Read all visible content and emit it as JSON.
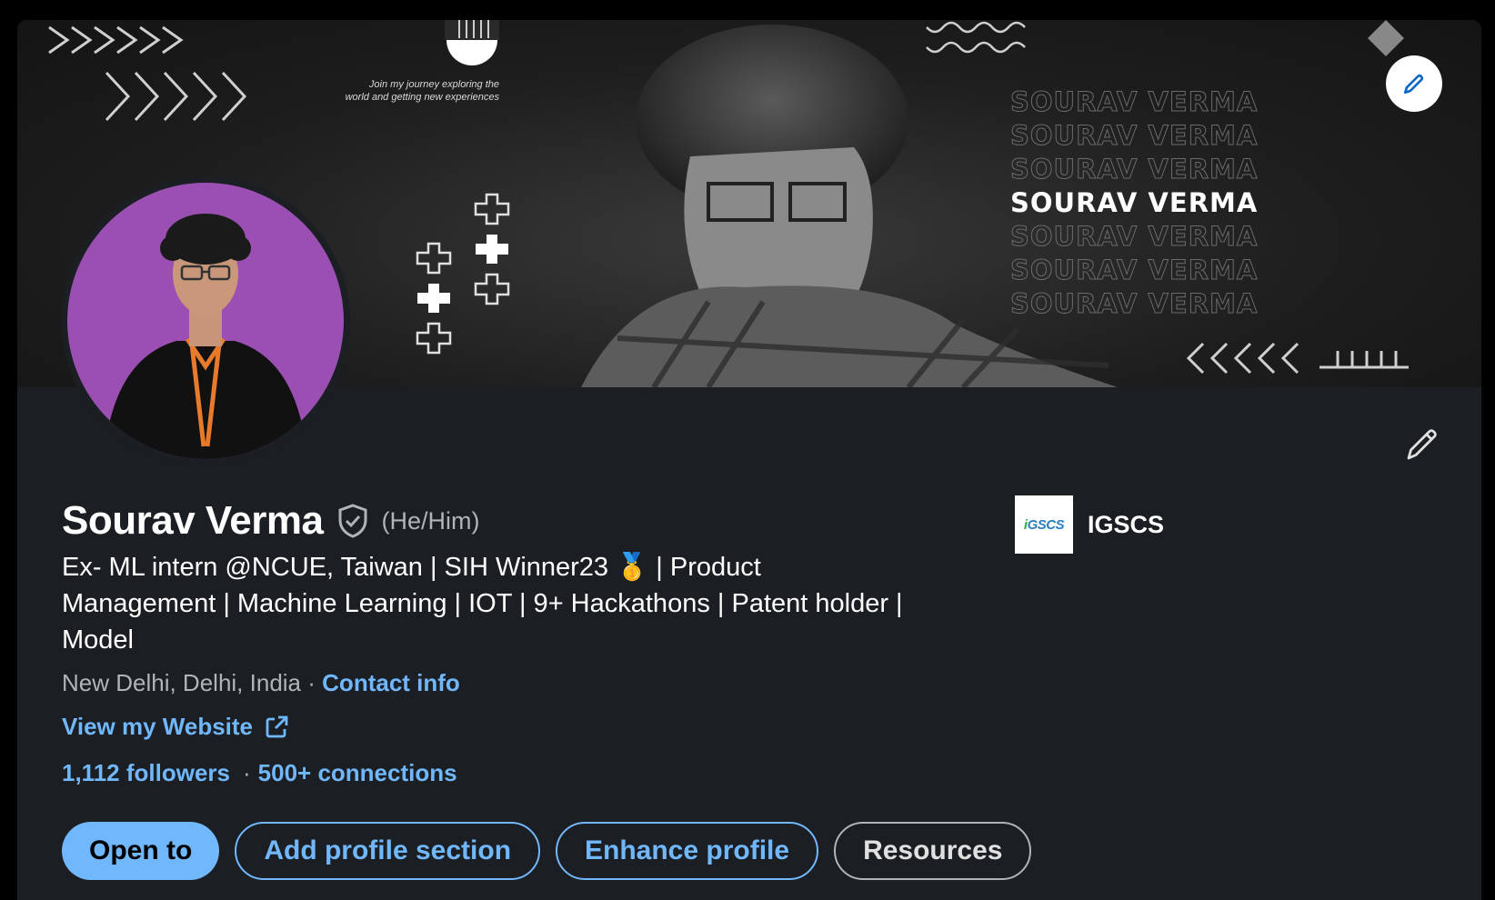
{
  "banner": {
    "journey_text": "Join my journey exploring the world and getting new experiences",
    "name_text": "SOURAV VERMA",
    "edit_icon": "pencil-icon"
  },
  "profile": {
    "name": "Sourav Verma",
    "verified_icon": "verified-shield-icon",
    "pronouns": "(He/Him)",
    "headline": "Ex- ML intern @NCUE, Taiwan | SIH Winner23 🥇 | Product Management | Machine Learning | IOT | 9+ Hackathons | Patent holder | Model",
    "location": "New Delhi, Delhi, India",
    "location_separator": "·",
    "contact_info": "Contact info",
    "website_label": "View my Website",
    "followers": "1,112 followers",
    "network_separator": "·",
    "connections": "500+ connections"
  },
  "company": {
    "logo_text_a": "i",
    "logo_text_b": "GSCS",
    "name": "IGSCS"
  },
  "actions": {
    "open_to": "Open to",
    "add_section": "Add profile section",
    "enhance": "Enhance profile",
    "resources": "Resources"
  },
  "colors": {
    "accent": "#71b7fb",
    "card_bg": "#1b1f23",
    "avatar_bg": "#9b4fb3"
  }
}
